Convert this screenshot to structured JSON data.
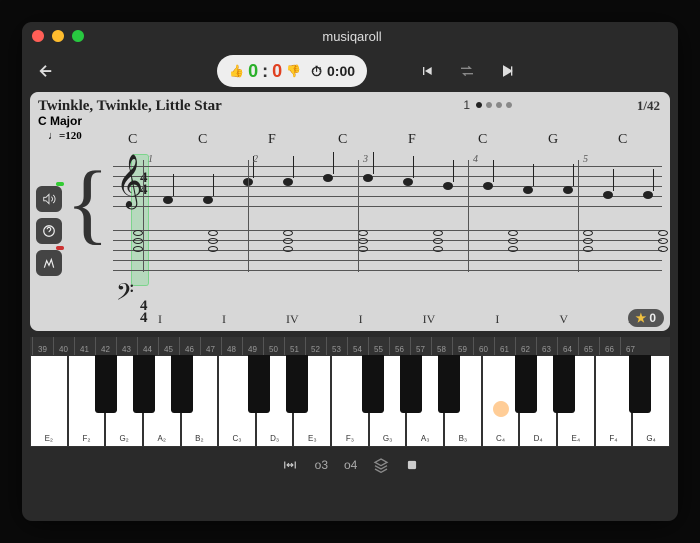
{
  "window": {
    "title": "musiqaroll"
  },
  "toolbar": {
    "score_left": "0",
    "score_right": "0",
    "score_sep": ":",
    "timer": "0:00"
  },
  "score": {
    "title": "Twinkle, Twinkle, Little Star",
    "key": "C Major",
    "tempo": "♩=120",
    "page_label": "1",
    "page_counter": "1/42",
    "chords": [
      "C",
      "C",
      "F",
      "C",
      "F",
      "C",
      "G",
      "C"
    ],
    "roman": [
      "I",
      "I",
      "IV",
      "I",
      "IV",
      "I",
      "V",
      "I"
    ],
    "measure_nums": [
      "1",
      "2",
      "3",
      "4",
      "5"
    ],
    "stars": "0"
  },
  "ruler_start": 39,
  "ruler_end": 67,
  "piano": {
    "white_keys": [
      "E₂",
      "F₂",
      "G₂",
      "A₂",
      "B₂",
      "C₃",
      "D₃",
      "E₃",
      "F₃",
      "G₃",
      "A₃",
      "B₃",
      "C₄",
      "D₄",
      "E₄",
      "F₄",
      "G₄"
    ],
    "highlight_index": 12,
    "middle_c_label": "4"
  },
  "bottom": {
    "oct_low": "o3",
    "oct_high": "o4"
  }
}
